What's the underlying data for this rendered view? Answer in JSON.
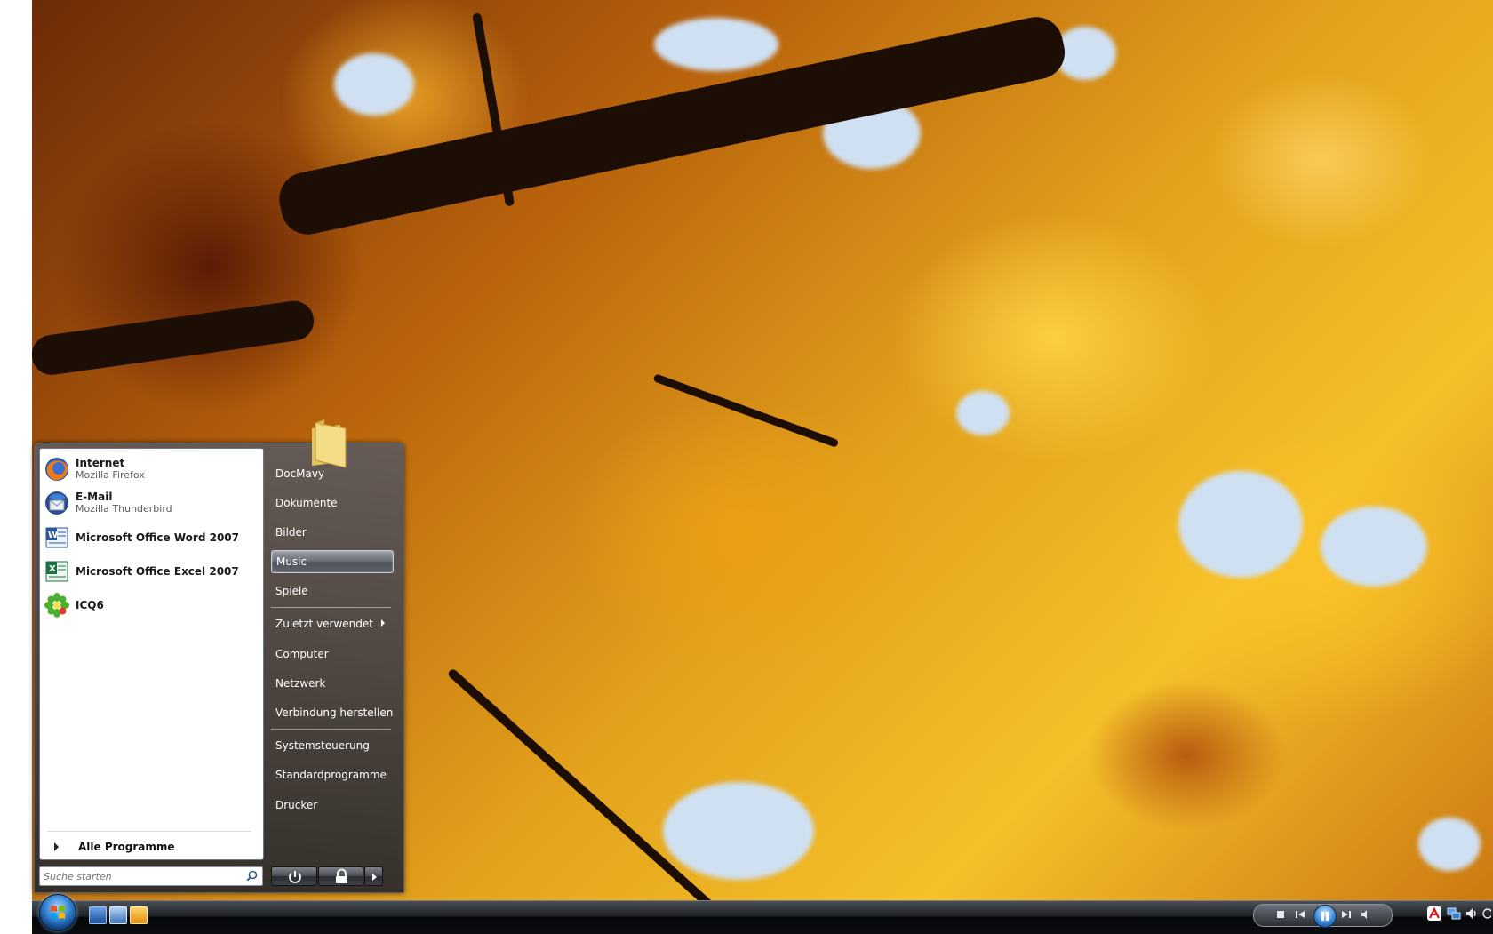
{
  "start_menu": {
    "pinned": [
      {
        "title": "Internet",
        "subtitle": "Mozilla Firefox",
        "icon": "firefox-icon"
      },
      {
        "title": "E-Mail",
        "subtitle": "Mozilla Thunderbird",
        "icon": "thunderbird-icon"
      },
      {
        "title": "Microsoft Office Word 2007",
        "subtitle": "",
        "icon": "word-icon"
      },
      {
        "title": "Microsoft Office Excel 2007",
        "subtitle": "",
        "icon": "excel-icon"
      },
      {
        "title": "ICQ6",
        "subtitle": "",
        "icon": "icq-icon"
      }
    ],
    "all_programs": "Alle Programme",
    "search_placeholder": "Suche starten",
    "right_items": [
      "DocMavy",
      "Dokumente",
      "Bilder",
      "Music",
      "Spiele",
      "Zuletzt verwendet",
      "Computer",
      "Netzwerk",
      "Verbindung herstellen",
      "Systemsteuerung",
      "Standardprogramme",
      "Drucker"
    ],
    "selected_right_item": "Music"
  },
  "taskbar": {
    "quick_launch": [
      "show-desktop-icon",
      "switch-windows-icon",
      "media-player-icon"
    ],
    "tray_icons": [
      "avira-icon",
      "network-icon",
      "volume-icon"
    ]
  },
  "colors": {
    "accent": "#3a8ad9",
    "taskbar": "#0b0d10",
    "menu_glass": "#3c3c41"
  }
}
